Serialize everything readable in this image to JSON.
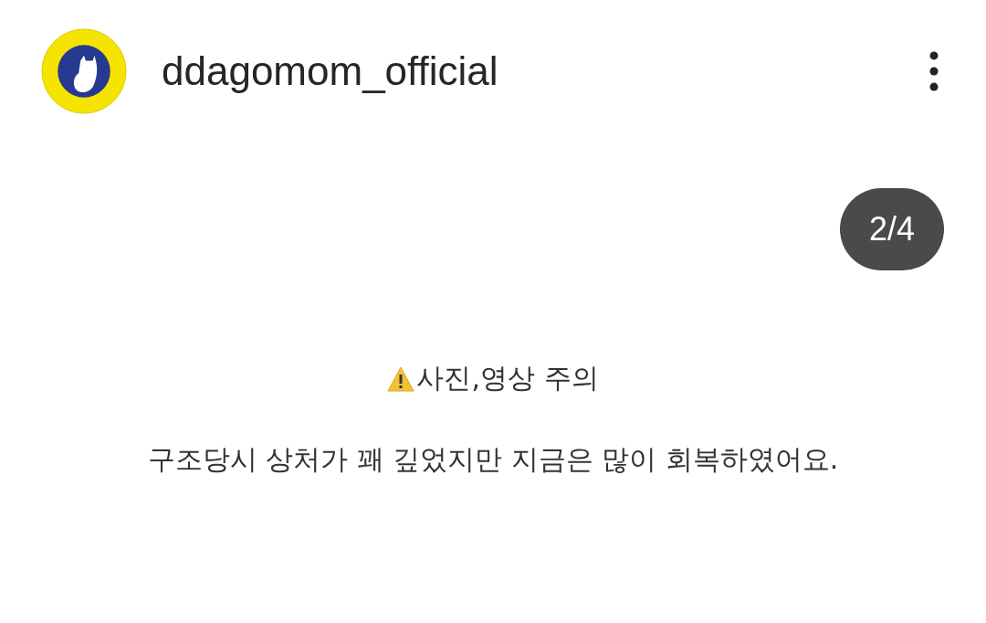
{
  "header": {
    "username": "ddagomom_official"
  },
  "post": {
    "counter": "2/4",
    "warning": "사진,영상 주의",
    "caption": "구조당시 상처가 꽤 깊었지만 지금은 많이 회복하였어요."
  }
}
